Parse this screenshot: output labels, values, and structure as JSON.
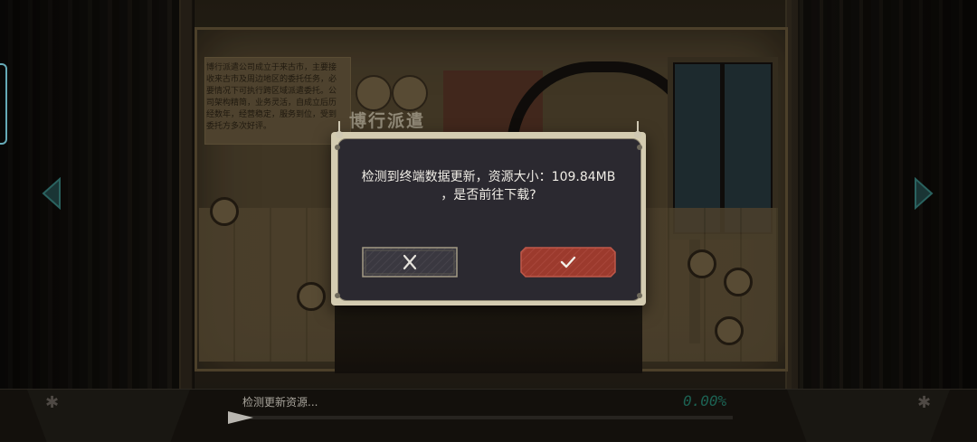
{
  "background": {
    "brand_text": "博行派遣",
    "intro_text": "博行派遣公司成立于来古市，主要接收来古市及周边地区的委托任务，必要情况下可执行跨区域派遣委托。公司架构精简，业务灵活，自成立后历经数年，经营稳定，服务到位，受到委托方多次好评。"
  },
  "dialog": {
    "message_line1": "检测到终端数据更新，资源大小：109.84MB",
    "message_line2": "，是否前往下载?",
    "cancel_icon": "close-icon",
    "confirm_icon": "check-icon"
  },
  "loading": {
    "status_text": "检测更新资源...",
    "percent_text": "0.00%",
    "progress": 0.0
  },
  "colors": {
    "accent_teal": "#1f6b5b",
    "progress_fill": "#7bd8c8",
    "confirm_red": "#9c3a2d",
    "dialog_bg": "#2b2930",
    "frame_beige": "#d4ccb1"
  },
  "navigation": {
    "left_arrow_icon": "chevron-left-icon",
    "right_arrow_icon": "chevron-right-icon"
  }
}
